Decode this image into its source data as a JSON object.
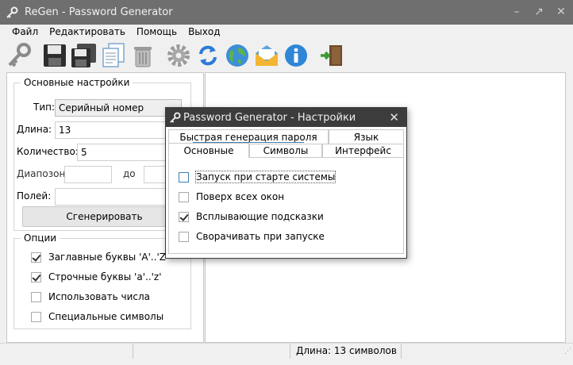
{
  "window": {
    "title": "ReGen - Password Generator",
    "controls": {
      "minimize": "–",
      "maximize": "↗",
      "close": "✕"
    }
  },
  "menu": [
    "Файл",
    "Редактировать",
    "Помощь",
    "Выход"
  ],
  "toolbar": {
    "icons": [
      "key-icon",
      "save-icon",
      "save-all-icon",
      "copy-icon",
      "trash-icon",
      "settings-gear-icon",
      "refresh-icon",
      "globe-icon",
      "mail-icon",
      "info-icon",
      "exit-door-icon"
    ]
  },
  "left": {
    "main_group_label": "Основные настройки",
    "type_label": "Тип:",
    "type_value": "Серийный номер",
    "length_label": "Длина:",
    "length_value": "13",
    "count_label": "Количество:",
    "count_value": "5",
    "range_label": "Диапозон:",
    "range_to_label": "до",
    "range_from_value": "",
    "range_to_value": "",
    "fields_label": "Полей:",
    "fields_value": "",
    "generate_button": "Сгенерировать",
    "options_group_label": "Опции",
    "options": [
      {
        "label": "Заглавные буквы 'A'..'Z'",
        "checked": true
      },
      {
        "label": "Строчные буквы 'a'..'z'",
        "checked": true
      },
      {
        "label": "Использовать числа",
        "checked": false
      },
      {
        "label": "Специальные символы",
        "checked": false
      }
    ]
  },
  "status": {
    "length_text": "Длина: 13 символов"
  },
  "dialog": {
    "title": "Password Generator - Настройки",
    "close": "✕",
    "tabs_back": [
      "Быстрая генерация пароля",
      "Язык"
    ],
    "tabs_front": [
      "Основные",
      "Символы",
      "Интерфейс"
    ],
    "options": [
      {
        "label": "Запуск при старте системы",
        "checked": false
      },
      {
        "label": "Поверх всех окон",
        "checked": false
      },
      {
        "label": "Всплывающие подсказки",
        "checked": true
      },
      {
        "label": "Сворачивать при запуске",
        "checked": false
      }
    ]
  },
  "colors": {
    "titlebar": "#6f6f6f",
    "dialog_titlebar": "#3c3c3c",
    "focus_accent": "#3c7fb1"
  }
}
